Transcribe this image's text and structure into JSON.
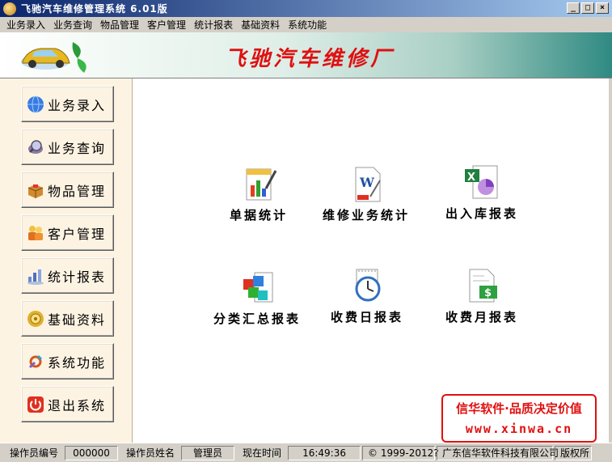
{
  "window": {
    "title": "飞驰汽车维修管理系统  6.01版",
    "controls": [
      "minimize",
      "maximize",
      "close"
    ]
  },
  "menu": [
    "业务录入",
    "业务查询",
    "物品管理",
    "客户管理",
    "统计报表",
    "基础资料",
    "系统功能"
  ],
  "banner": {
    "title": "飞驰汽车维修厂"
  },
  "sidebar": {
    "items": [
      {
        "label": "业务录入",
        "icon": "globe-icon"
      },
      {
        "label": "业务查询",
        "icon": "magnifier-icon"
      },
      {
        "label": "物品管理",
        "icon": "box-icon"
      },
      {
        "label": "客户管理",
        "icon": "clients-icon"
      },
      {
        "label": "统计报表",
        "icon": "bar-chart-icon"
      },
      {
        "label": "基础资料",
        "icon": "database-icon"
      },
      {
        "label": "系统功能",
        "icon": "tools-icon"
      },
      {
        "label": "退出系统",
        "icon": "power-icon"
      }
    ]
  },
  "reports": [
    {
      "label": "单据统计",
      "icon": "document-chart-icon"
    },
    {
      "label": "维修业务统计",
      "icon": "word-document-icon"
    },
    {
      "label": "出入库报表",
      "icon": "excel-report-icon"
    },
    {
      "label": "分类汇总报表",
      "icon": "cubes-icon"
    },
    {
      "label": "收费日报表",
      "icon": "clock-calendar-icon"
    },
    {
      "label": "收费月报表",
      "icon": "money-document-icon"
    }
  ],
  "promo": {
    "line1": "信华软件·品质决定价值",
    "line2": "www.xinwa.cn"
  },
  "status": {
    "operator_id_label": "操作员编号",
    "operator_id": "000000",
    "operator_name_label": "操作员姓名",
    "operator_name": "管理员",
    "time_label": "现在时间",
    "time": "16:49:36",
    "copyright": "© 1999-2012?",
    "company": "广东信华软件科技有限公司",
    "rights": "版权所"
  }
}
